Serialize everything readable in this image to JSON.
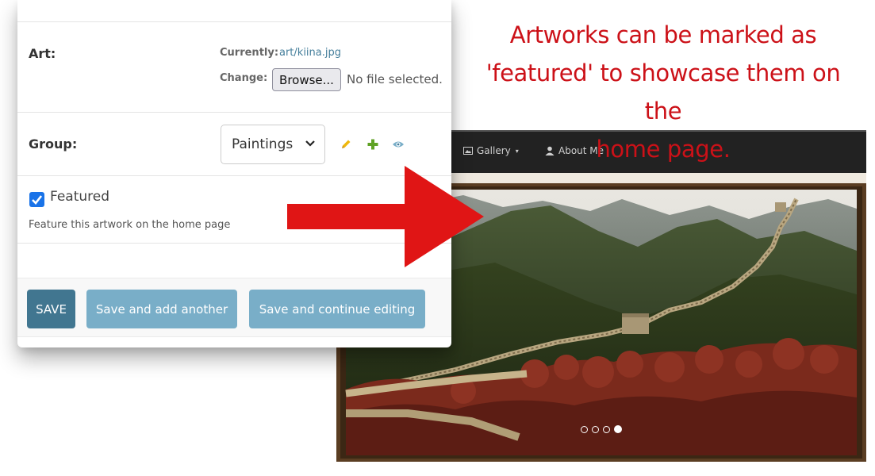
{
  "callout": {
    "line1": "Artworks can be marked as",
    "line2": "'featured' to showcase them on the",
    "line3": "home page."
  },
  "form": {
    "art": {
      "label": "Art:",
      "currently_label": "Currently:",
      "current_file": "art/kiina.jpg",
      "change_label": "Change:",
      "browse_label": "Browse...",
      "no_file_text": "No file selected."
    },
    "group": {
      "label": "Group:",
      "selected": "Paintings",
      "icons": [
        "edit-icon",
        "add-icon",
        "view-icon"
      ]
    },
    "featured": {
      "checked": true,
      "label": "Featured",
      "help_text": "Feature this artwork on the home page"
    },
    "buttons": {
      "save": "SAVE",
      "save_add": "Save and add another",
      "save_continue": "Save and continue editing"
    }
  },
  "site": {
    "nav": {
      "gallery": "Gallery",
      "about": "About Me"
    },
    "carousel": {
      "slide_count": 4,
      "active_index": 3
    }
  },
  "colors": {
    "accent_red": "#cc1118",
    "django_primary": "#417690",
    "django_secondary": "#79aec8",
    "link": "#447e9b",
    "checkbox": "#1a73e8",
    "nav_bg": "#222222"
  }
}
